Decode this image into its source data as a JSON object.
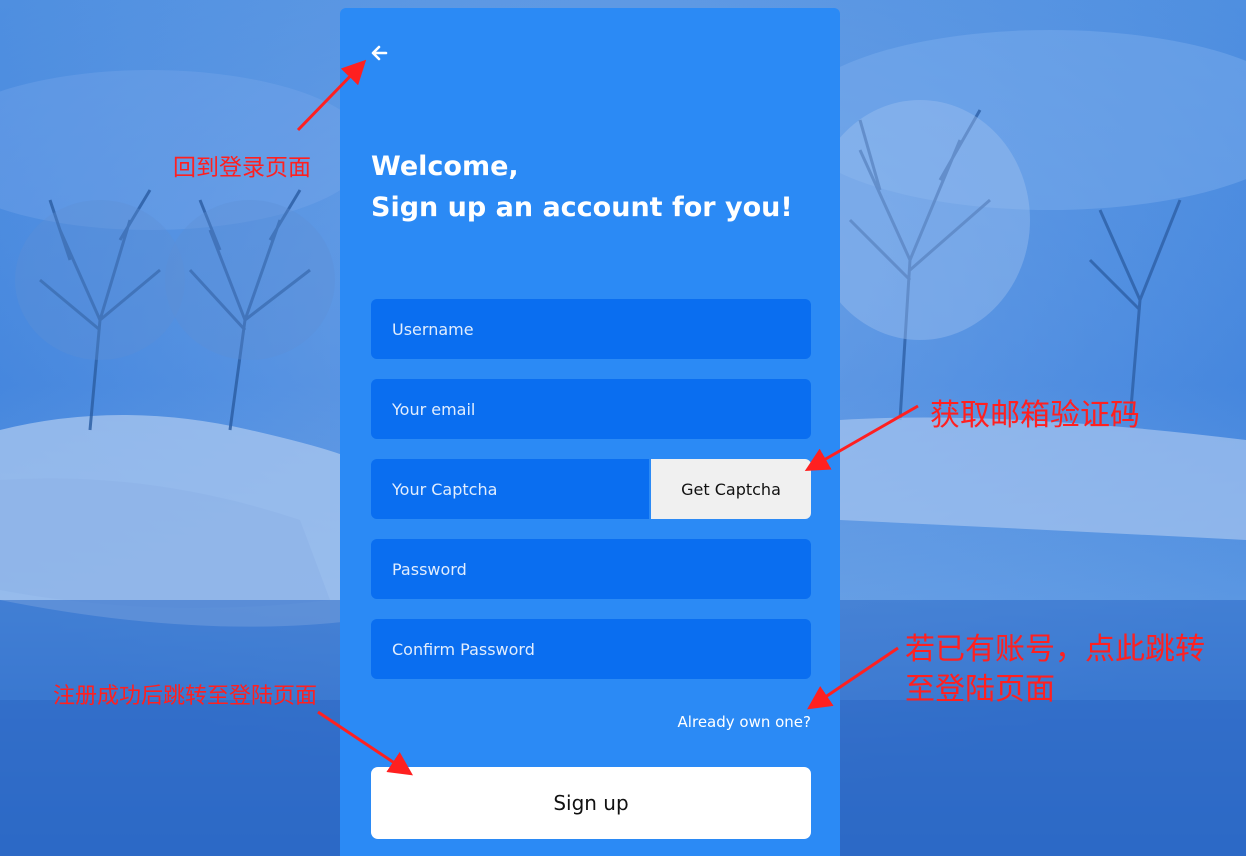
{
  "colors": {
    "card": "#2b8af5",
    "field": "#0a6ef0",
    "annotation": "#ff2020",
    "background": "#3d7fd6"
  },
  "back_icon": "arrow-left-icon",
  "heading": {
    "line1": "Welcome,",
    "line2": "Sign up an account for you!"
  },
  "form": {
    "username_placeholder": "Username",
    "email_placeholder": "Your email",
    "captcha_placeholder": "Your Captcha",
    "get_captcha_label": "Get Captcha",
    "password_placeholder": "Password",
    "confirm_password_placeholder": "Confirm Password",
    "already_link": "Already own one?",
    "signup_label": "Sign up"
  },
  "annotations": {
    "back": "回到登录页面",
    "captcha": "获取邮箱验证码",
    "already_line1": "若已有账号，点此跳转",
    "already_line2": "至登陆页面",
    "signup": "注册成功后跳转至登陆页面"
  }
}
